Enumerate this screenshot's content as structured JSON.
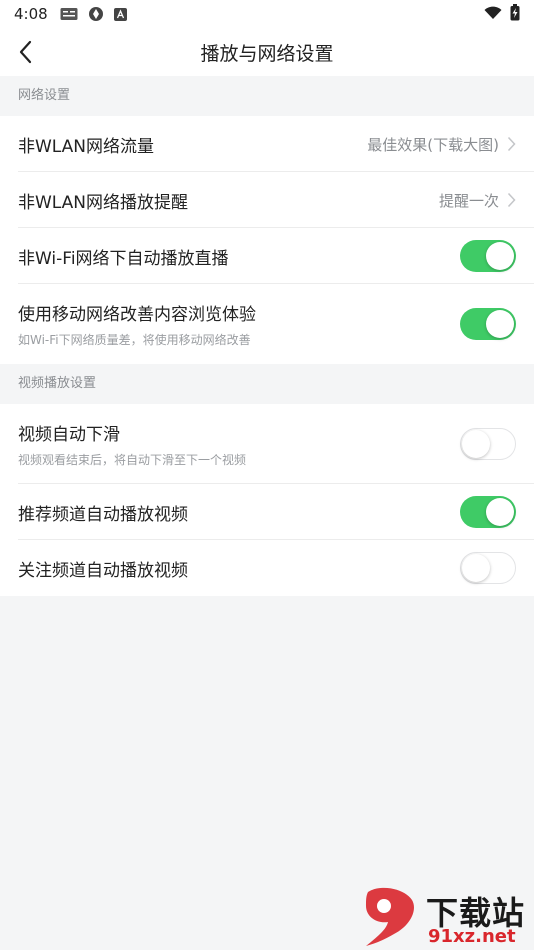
{
  "status": {
    "time": "4:08",
    "left_icons": [
      "news-badge-icon",
      "sync-icon",
      "font-a-icon"
    ],
    "right_icons": [
      "wifi-icon",
      "battery-charging-icon"
    ]
  },
  "header": {
    "title": "播放与网络设置"
  },
  "sections": [
    {
      "title": "网络设置",
      "rows": [
        {
          "label": "非WLAN网络流量",
          "value": "最佳效果(下载大图)"
        },
        {
          "label": "非WLAN网络播放提醒",
          "value": "提醒一次"
        },
        {
          "label": "非Wi-Fi网络下自动播放直播",
          "on": true
        },
        {
          "label": "使用移动网络改善内容浏览体验",
          "subtitle": "如Wi-Fi下网络质量差，将使用移动网络改善",
          "on": true
        }
      ]
    },
    {
      "title": "视频播放设置",
      "rows": [
        {
          "label": "视频自动下滑",
          "subtitle": "视频观看结束后，将自动下滑至下一个视频",
          "on": false
        },
        {
          "label": "推荐频道自动播放视频",
          "on": true
        },
        {
          "label": "关注频道自动播放视频",
          "on": false
        }
      ]
    }
  ],
  "watermark": {
    "logo_text": "91",
    "top_text": "下载站",
    "bottom_text": "91xz.net"
  },
  "colors": {
    "toggle_on": "#3fcb66",
    "background": "#f4f5f6"
  }
}
